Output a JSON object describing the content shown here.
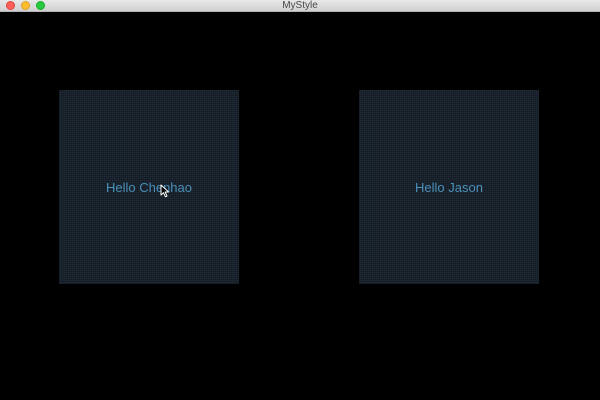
{
  "window": {
    "title": "MyStyle"
  },
  "cards": [
    {
      "label": "Hello Chenhao"
    },
    {
      "label": "Hello Jason"
    }
  ],
  "icons": {
    "close": "close-icon",
    "minimize": "minimize-icon",
    "maximize": "maximize-icon",
    "cursor": "mouse-pointer-icon"
  },
  "colors": {
    "background": "#000000",
    "card": "#1e2a36",
    "label": "#4a8fb8"
  }
}
